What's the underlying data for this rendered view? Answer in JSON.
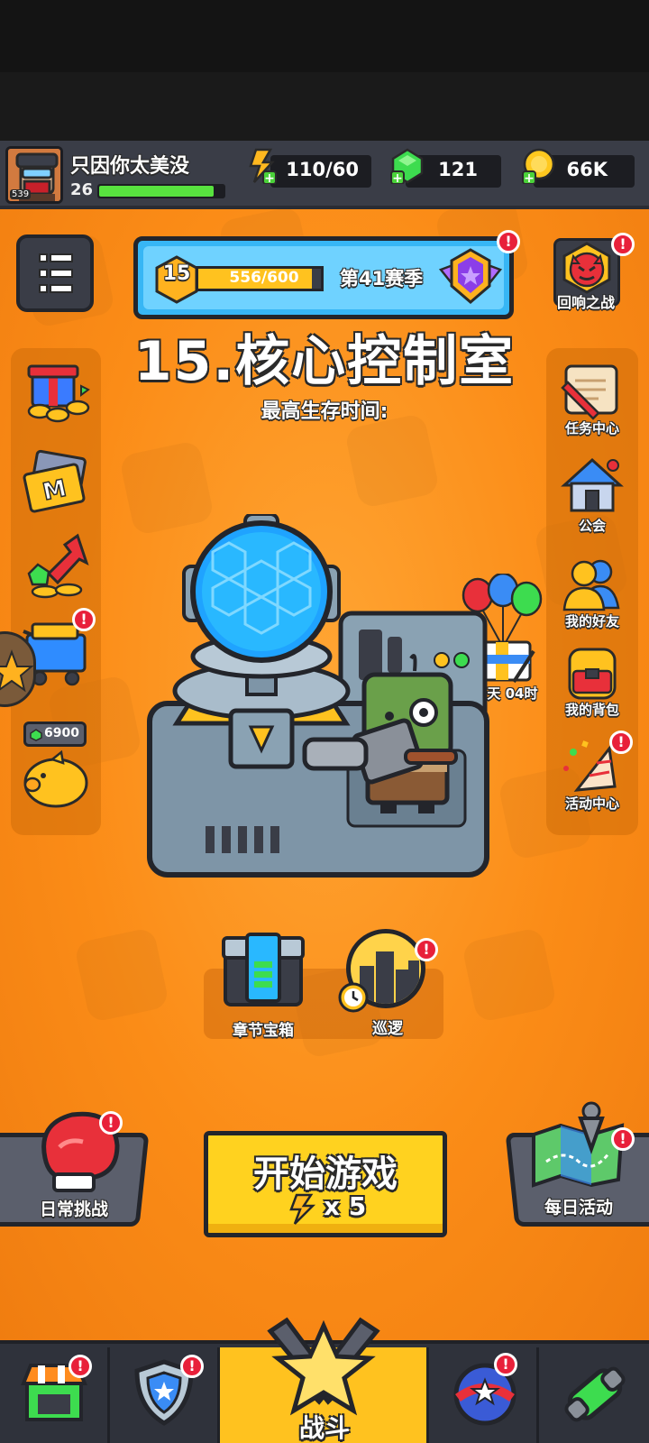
{
  "player": {
    "name": "只因你太美没",
    "level": "26",
    "level_badge": "539",
    "xp_fraction": 0.92
  },
  "resources": {
    "energy": "110/60",
    "gems": "121",
    "coins": "66K"
  },
  "season": {
    "tier": "15",
    "progress_text": "556/600",
    "progress_fraction": 0.93,
    "label": "第41赛季"
  },
  "stage": {
    "title": "15.核心控制室",
    "subtitle": "最高生存时间:"
  },
  "left_menu": {
    "piggy_gems": "6900"
  },
  "right_menu": {
    "echo_battle": "回响之战",
    "tasks": "任务中心",
    "guild": "公会",
    "friends": "我的好友",
    "backpack": "我的背包",
    "events": "活动中心"
  },
  "gift": {
    "timer": "04天 04时"
  },
  "chest": {
    "chapter_chest": "章节宝箱",
    "patrol": "巡逻"
  },
  "actions": {
    "daily_challenge": "日常挑战",
    "start_game": "开始游戏",
    "start_cost": "x 5",
    "daily_activity": "每日活动"
  },
  "nav": {
    "battle": "战斗"
  },
  "badge_mark": "!",
  "colors": {
    "orange": "#fb8c17",
    "dark_panel": "#3a3d47",
    "gold": "#ffd21f",
    "badge_red": "#e8203a",
    "blue_frame": "#37b6f5"
  }
}
